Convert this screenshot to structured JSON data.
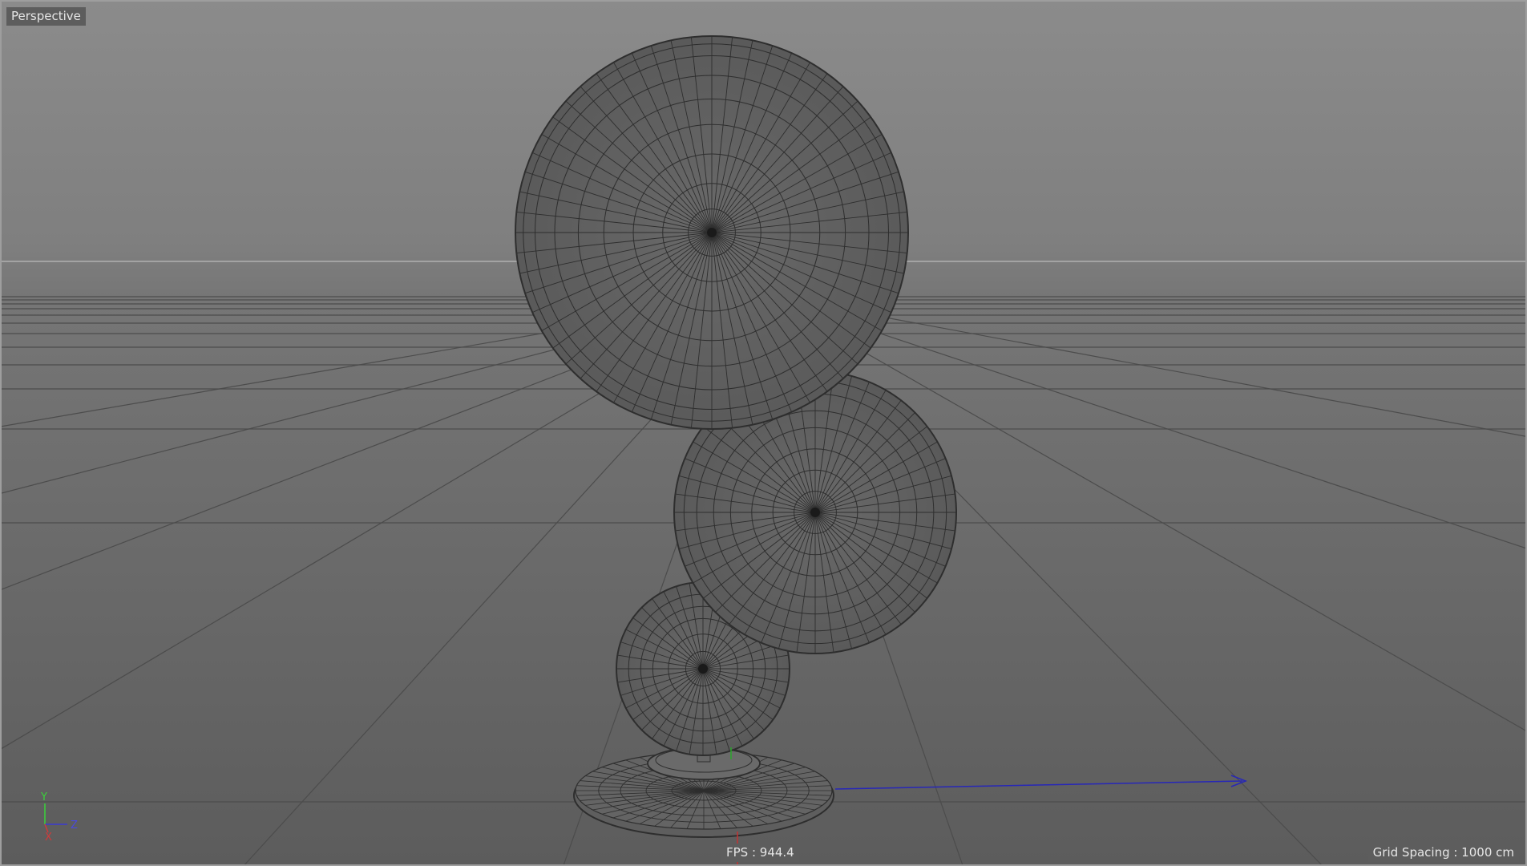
{
  "viewport": {
    "camera_label": "Perspective",
    "fps_label": "FPS : 944.4",
    "grid_spacing_label": "Grid Spacing : 1000 cm"
  },
  "axis_gizmo": {
    "y": "Y",
    "z": "Z",
    "x": "X",
    "colors": {
      "x": "#d23a3a",
      "y": "#3ad23a",
      "z": "#3a3ad2"
    }
  },
  "scene": {
    "shading": "wireframe",
    "objects": [
      "large-disc",
      "medium-disc",
      "small-disc",
      "base-stand"
    ]
  }
}
